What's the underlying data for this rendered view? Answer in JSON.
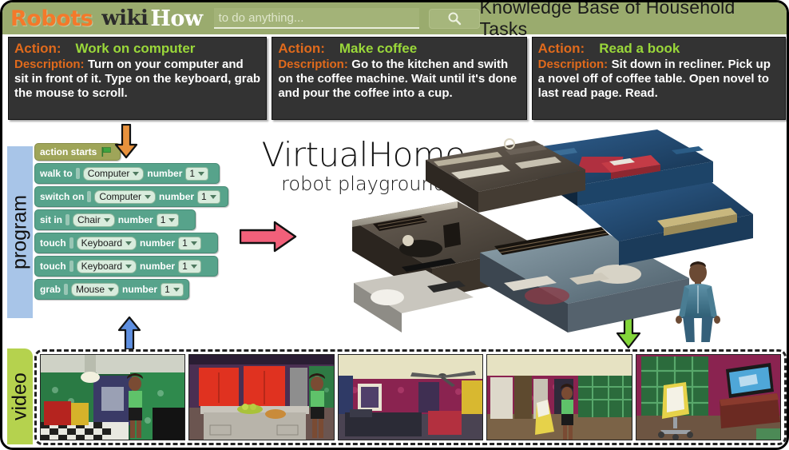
{
  "header": {
    "logo_robots": "Robots",
    "logo_wiki": "wiki",
    "logo_how": "How",
    "search_placeholder": "to do anything...",
    "search_value": "",
    "search_icon": "search-icon",
    "title": "Knowledge Base of Household Tasks"
  },
  "cards": [
    {
      "action_label": "Action:",
      "action_value": "Work on computer",
      "description_label": "Description:",
      "description_value": "Turn on your computer and sit in front of it. Type on the keyboard, grab the mouse to scroll."
    },
    {
      "action_label": "Action:",
      "action_value": "Make coffee",
      "description_label": "Description:",
      "description_value": "Go to the kitchen and swith on the coffee machine. Wait until it's done and pour the coffee into a cup."
    },
    {
      "action_label": "Action:",
      "action_value": "Read a book",
      "description_label": "Description:",
      "description_value": "Sit down in recliner. Pick up a novel off of coffee table. Open novel to last read page. Read."
    }
  ],
  "side_labels": {
    "program": "program",
    "video": "video"
  },
  "program": {
    "start_block": {
      "label": "action starts",
      "icon": "green-flag-icon"
    },
    "steps": [
      {
        "verb": "walk  to",
        "object": "Computer",
        "number_word": "number",
        "number": "1"
      },
      {
        "verb": "switch on",
        "object": "Computer",
        "number_word": "number",
        "number": "1"
      },
      {
        "verb": "sit  in",
        "object": "Chair",
        "number_word": "number",
        "number": "1"
      },
      {
        "verb": "touch",
        "object": "Keyboard",
        "number_word": "number",
        "number": "1"
      },
      {
        "verb": "touch",
        "object": "Keyboard",
        "number_word": "number",
        "number": "1"
      },
      {
        "verb": "grab",
        "object": "Mouse",
        "number_word": "number",
        "number": "1"
      }
    ]
  },
  "title": {
    "main": "VirtualHome",
    "sub": "robot playground"
  },
  "arrows": [
    {
      "name": "orange-down-arrow",
      "color": "#e8913c",
      "direction": "down"
    },
    {
      "name": "pink-right-arrow",
      "color": "#f2607a",
      "direction": "right"
    },
    {
      "name": "blue-up-arrow",
      "color": "#5e8fe0",
      "direction": "up"
    },
    {
      "name": "green-down-arrow",
      "color": "#83d63a",
      "direction": "down"
    }
  ],
  "scene": {
    "name": "apartment-3d-render",
    "avatar": "humanoid-agent"
  },
  "video_thumbnails": [
    {
      "name": "video-frame-bathroom-green"
    },
    {
      "name": "video-frame-kitchen-red-cabinets"
    },
    {
      "name": "video-frame-bedroom-ceiling-fan"
    },
    {
      "name": "video-frame-bedroom-wardrobe"
    },
    {
      "name": "video-frame-study-tv-chair"
    }
  ],
  "colors": {
    "header_bg": "#9aab6e",
    "card_bg": "#333333",
    "action_label": "#e06a1c",
    "action_value": "#9ad83a",
    "program_side": "#a8c5e8",
    "video_side": "#b5d24e",
    "block_green": "#57a38b",
    "block_olive": "#9fa559"
  }
}
